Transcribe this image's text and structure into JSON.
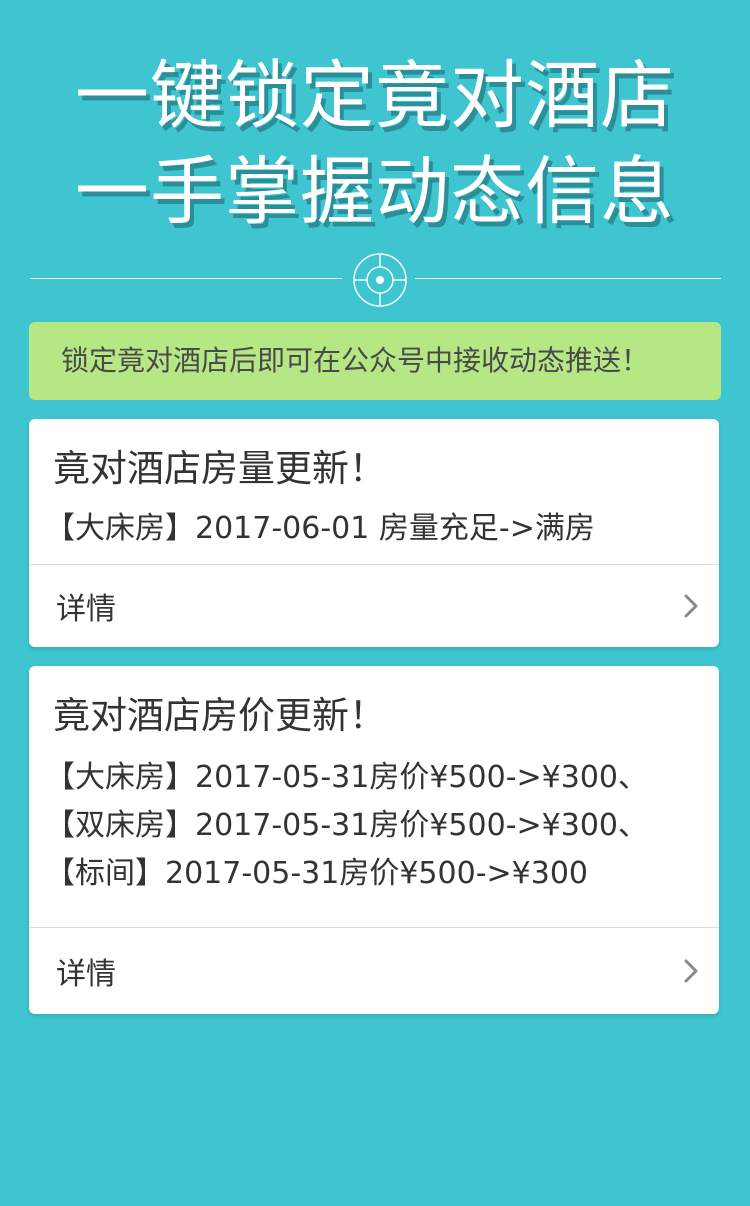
{
  "hero": {
    "line1": "一键锁定竟对酒店",
    "line2": "一手掌握动态信息"
  },
  "divider": {
    "icon": "target-icon"
  },
  "notice": {
    "text": "锁定竟对酒店后即可在公众号中接收动态推送！"
  },
  "cards": [
    {
      "title": "竟对酒店房量更新！",
      "lines": [
        "【大床房】2017-06-01 房量充足->满房"
      ],
      "footer_label": "详情",
      "footer_icon": "chevron-right-icon"
    },
    {
      "title": "竟对酒店房价更新！",
      "lines": [
        "【大床房】2017-05-31房价¥500->¥300、",
        "【双床房】2017-05-31房价¥500->¥300、",
        "【标间】2017-05-31房价¥500->¥300"
      ],
      "footer_label": "详情",
      "footer_icon": "chevron-right-icon"
    }
  ],
  "colors": {
    "background": "#3ec5cf",
    "notice_bg": "#b5e884",
    "card_bg": "#ffffff",
    "text": "#333333"
  }
}
